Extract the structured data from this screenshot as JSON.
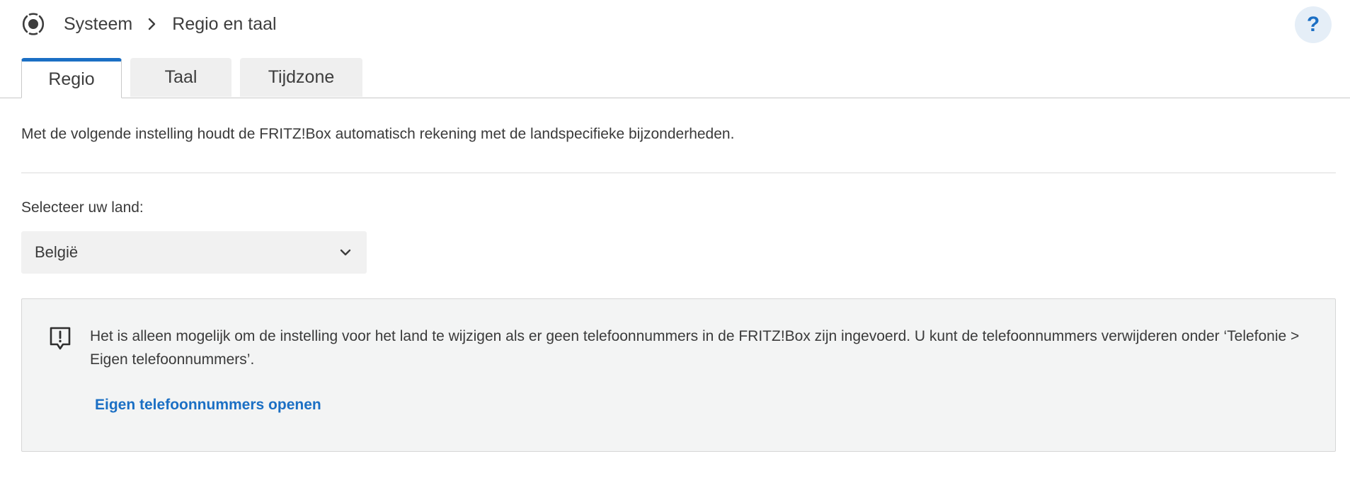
{
  "breadcrumb": {
    "icon": "system-icon",
    "parent": "Systeem",
    "separator_icon": "chevron-right-icon",
    "current": "Regio en taal"
  },
  "help": {
    "label": "?",
    "icon": "help-icon"
  },
  "tabs": [
    {
      "label": "Regio",
      "active": true
    },
    {
      "label": "Taal",
      "active": false
    },
    {
      "label": "Tijdzone",
      "active": false
    }
  ],
  "intro": "Met de volgende instelling houdt de FRITZ!Box automatisch rekening met de landspecifieke bijzonderheden.",
  "country": {
    "label": "Selecteer uw land:",
    "selected": "België",
    "chevron_icon": "chevron-down-icon"
  },
  "notice": {
    "icon": "alert-message-icon",
    "text": "Het is alleen mogelijk om de instelling voor het land te wijzigen als er geen telefoonnummers in de FRITZ!Box zijn ingevoerd. U kunt de telefoonnummers verwijderen onder ‘Telefonie > Eigen telefoonnummers’.",
    "link": "Eigen telefoonnummers openen"
  },
  "colors": {
    "accent": "#1b6fc4",
    "help_bg": "#e5eef7",
    "panel_bg": "#f3f4f4",
    "select_bg": "#f1f1f1"
  }
}
